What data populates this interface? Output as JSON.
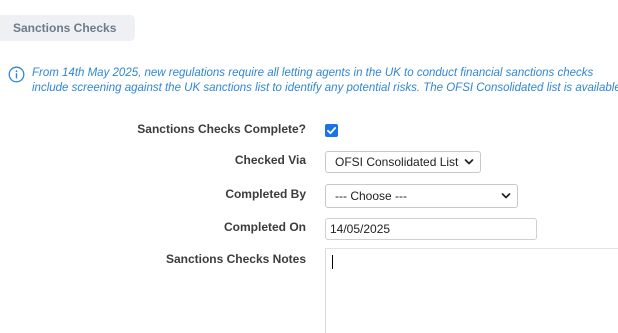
{
  "section": {
    "title": "Sanctions Checks"
  },
  "notice": {
    "icon": "info-icon",
    "color": "#2f86d6",
    "line1": "From 14th May 2025, new regulations require all letting agents in the UK to conduct financial sanctions checks",
    "line2": "include screening against the UK sanctions list to identify any potential risks. The OFSI Consolidated list is available"
  },
  "form": {
    "complete": {
      "label": "Sanctions Checks Complete?",
      "checked": true,
      "accent": "#1a73e8"
    },
    "checked_via": {
      "label": "Checked Via",
      "value": "OFSI Consolidated List"
    },
    "completed_by": {
      "label": "Completed By",
      "value": "--- Choose ---"
    },
    "completed_on": {
      "label": "Completed On",
      "value": "14/05/2025"
    },
    "notes": {
      "label": "Sanctions Checks Notes",
      "value": ""
    }
  }
}
